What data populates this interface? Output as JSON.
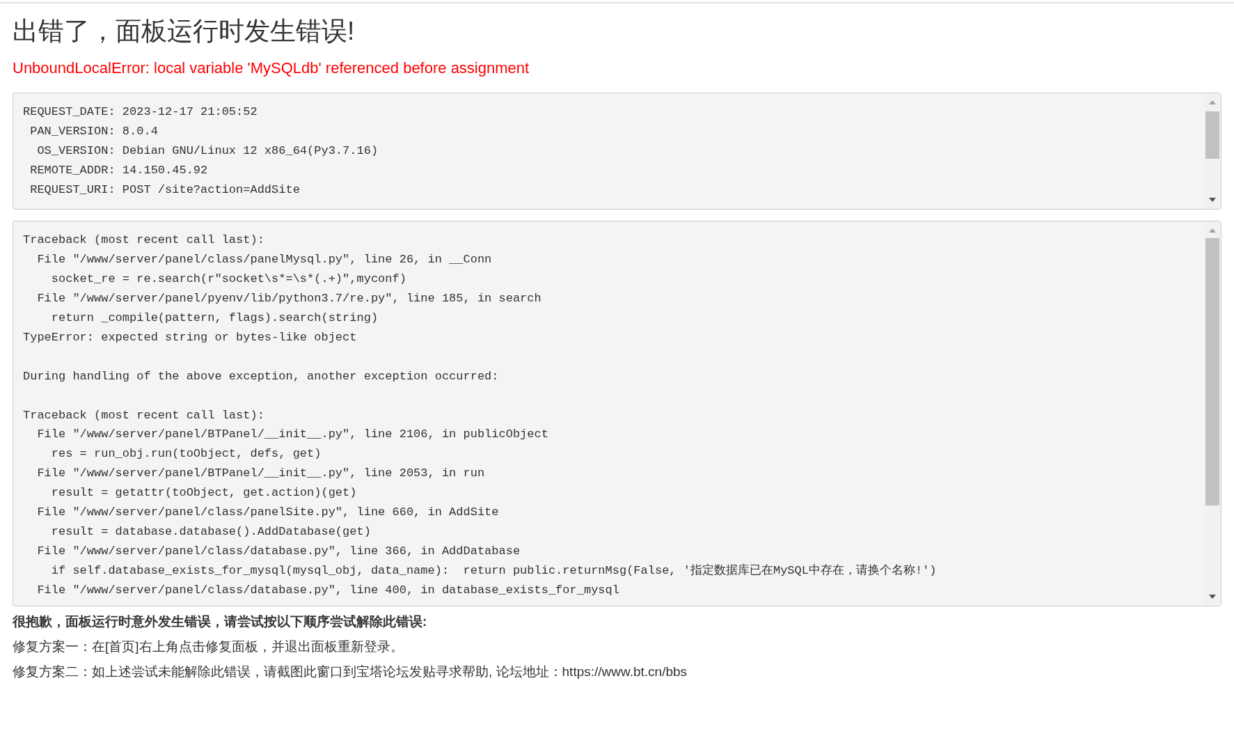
{
  "title": "出错了，面板运行时发生错误!",
  "error_message": "UnboundLocalError: local variable 'MySQLdb' referenced before assignment",
  "request_info": {
    "lines": [
      "REQUEST_DATE: 2023-12-17 21:05:52",
      " PAN_VERSION: 8.0.4",
      "  OS_VERSION: Debian GNU/Linux 12 x86_64(Py3.7.16)",
      " REMOTE_ADDR: 14.150.45.92",
      " REQUEST_URI: POST /site?action=AddSite"
    ]
  },
  "traceback": {
    "sections": [
      [
        "Traceback (most recent call last):",
        "  File \"/www/server/panel/class/panelMysql.py\", line 26, in __Conn",
        "    socket_re = re.search(r\"socket\\s*=\\s*(.+)\",myconf)",
        "  File \"/www/server/panel/pyenv/lib/python3.7/re.py\", line 185, in search",
        "    return _compile(pattern, flags).search(string)",
        "TypeError: expected string or bytes-like object"
      ],
      [
        "During handling of the above exception, another exception occurred:"
      ],
      [
        "Traceback (most recent call last):",
        "  File \"/www/server/panel/BTPanel/__init__.py\", line 2106, in publicObject",
        "    res = run_obj.run(toObject, defs, get)",
        "  File \"/www/server/panel/BTPanel/__init__.py\", line 2053, in run",
        "    result = getattr(toObject, get.action)(get)",
        "  File \"/www/server/panel/class/panelSite.py\", line 660, in AddSite",
        "    result = database.database().AddDatabase(get)",
        "  File \"/www/server/panel/class/database.py\", line 366, in AddDatabase",
        "    if self.database_exists_for_mysql(mysql_obj, data_name):  return public.returnMsg(False, '指定数据库已在MySQL中存在，请换个名称!')",
        "  File \"/www/server/panel/class/database.py\", line 400, in database_exists_for_mysql"
      ]
    ]
  },
  "help": {
    "heading": "很抱歉，面板运行时意外发生错误，请尝试按以下顺序尝试解除此错误:",
    "fixes": [
      "修复方案一：在[首页]右上角点击修复面板，并退出面板重新登录。",
      "修复方案二：如上述尝试未能解除此错误，请截图此窗口到宝塔论坛发贴寻求帮助, 论坛地址：https://www.bt.cn/bbs"
    ]
  }
}
